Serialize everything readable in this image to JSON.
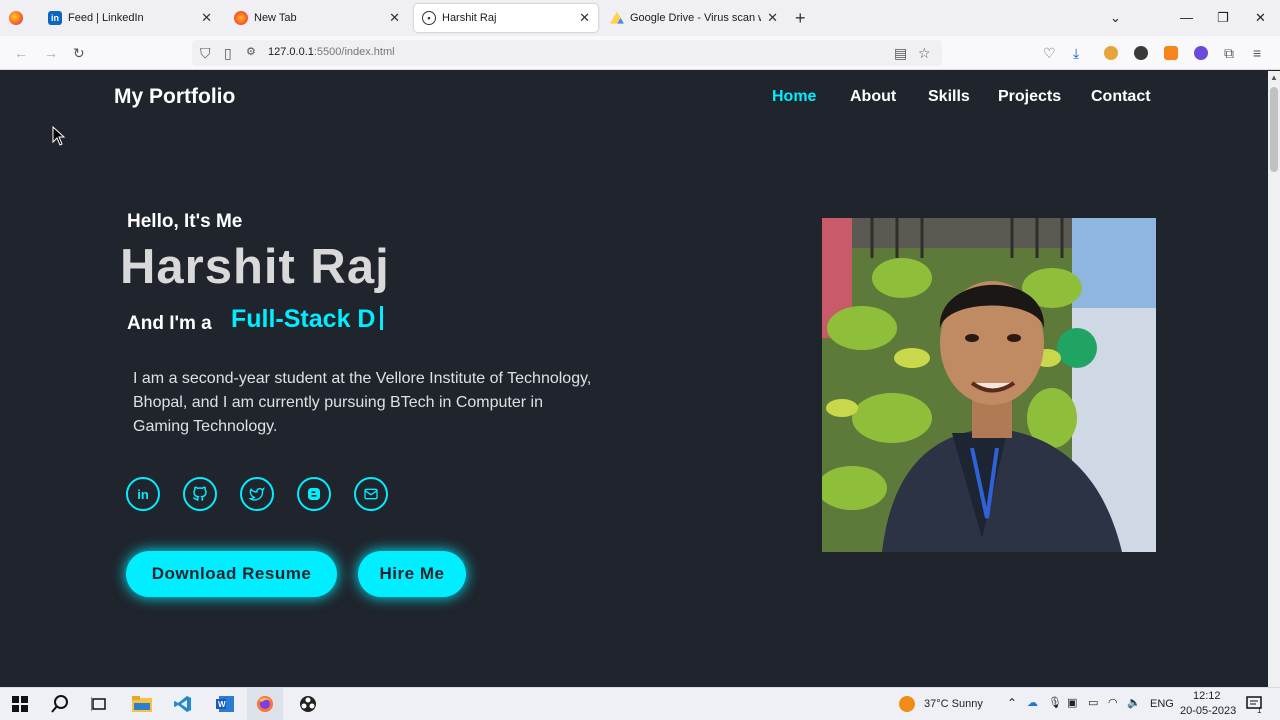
{
  "browser": {
    "tabs": [
      {
        "title": "Feed | LinkedIn",
        "favicon": "linkedin-icon"
      },
      {
        "title": "New Tab",
        "favicon": "firefox-icon"
      },
      {
        "title": "Harshit Raj",
        "favicon": "person-icon",
        "active": true
      },
      {
        "title": "Google Drive - Virus scan warn",
        "favicon": "google-drive-icon"
      }
    ],
    "url_host": "127.0.0.1",
    "url_path": ":5500/index.html"
  },
  "site": {
    "logo": "My Portfolio",
    "nav": [
      "Home",
      "About",
      "Skills",
      "Projects",
      "Contact"
    ],
    "active_nav": "Home",
    "greeting": "Hello, It's Me",
    "name": "Harshit Raj",
    "role_prefix": "And I'm a",
    "role_typed": "Full-Stack D",
    "description": "I am a second-year student at the Vellore Institute of Technology, Bhopal, and I am currently pursuing BTech in Computer in Gaming Technology.",
    "social": [
      "linkedin-icon",
      "github-icon",
      "twitter-icon",
      "blogger-icon",
      "mail-icon"
    ],
    "buttons": {
      "download": "Download Resume",
      "hire": "Hire Me"
    },
    "accent": "#00eeff",
    "background": "#1f242d"
  },
  "taskbar": {
    "weather": "37°C  Sunny",
    "language": "ENG",
    "time": "12:12",
    "date": "20-05-2023",
    "notification_count": "1"
  }
}
